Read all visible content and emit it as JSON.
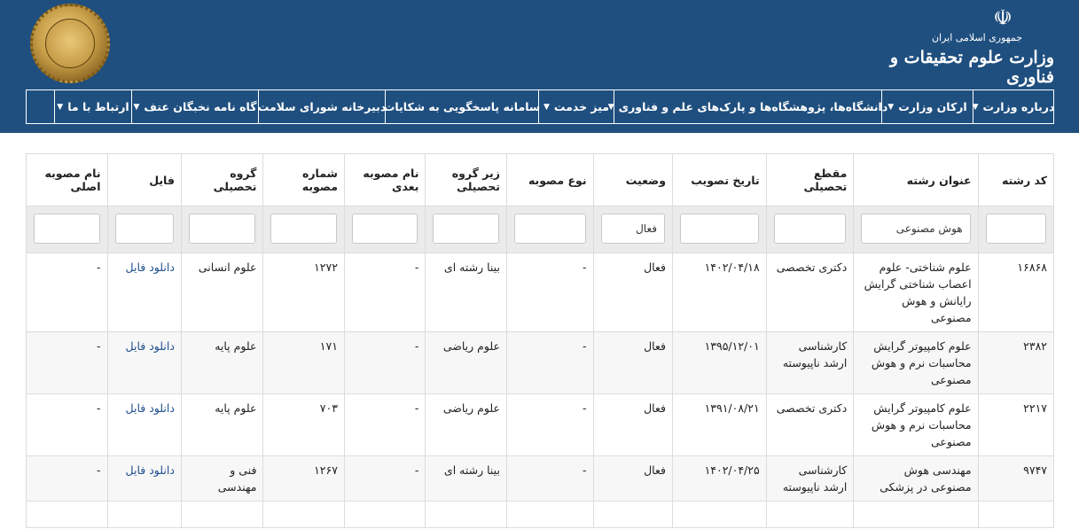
{
  "header": {
    "emblem_icon": "iran-emblem-icon",
    "ministry_small": "جمهوری اسلامی ایران",
    "ministry_name": "وزارت علوم تحقیقات و فناوری",
    "seal_icon": "gold-seal-icon"
  },
  "nav": {
    "items": [
      {
        "label": "درباره وزارت",
        "dropdown": true
      },
      {
        "label": "ارکان وزارت",
        "dropdown": true
      },
      {
        "label": "دانشگاه‌ها، پژوهشگاه‌ها و پارک‌های علم و فناوری",
        "dropdown": true
      },
      {
        "label": "میز خدمت",
        "dropdown": true
      },
      {
        "label": "سامانه پاسخگویی به شکایات",
        "dropdown": false
      },
      {
        "label": "دبیرخانه شورای سلامت",
        "dropdown": false
      },
      {
        "label": "گاه نامه نخبگان عتف",
        "dropdown": true
      },
      {
        "label": "ارتباط با ما",
        "dropdown": true
      },
      {
        "label": "",
        "dropdown": false
      }
    ]
  },
  "table": {
    "headers": [
      "کد رشته",
      "عنوان رشته",
      "مقطع تحصیلی",
      "تاریخ تصویب",
      "وضعیت",
      "نوع مصوبه",
      "زیر گروه تحصیلی",
      "نام مصوبه بعدی",
      "شماره مصوبه",
      "گروه تحصیلی",
      "فایل",
      "نام مصوبه اصلی"
    ],
    "filters": [
      "",
      "هوش مصنوعی",
      "",
      "",
      "فعال",
      "",
      "",
      "",
      "",
      "",
      "",
      ""
    ],
    "rows": [
      [
        "۱۶۸۶۸",
        "علوم شناختی- علوم اعصاب شناختی گرایش رایانش و هوش مصنوعی",
        "دکتری تخصصی",
        "۱۴۰۲/۰۴/۱۸",
        "فعال",
        "-",
        "بینا رشته ای",
        "-",
        "۱۲۷۲",
        "علوم انسانی",
        "دانلود فایل",
        "-"
      ],
      [
        "۲۳۸۲",
        "علوم کامپیوتر گرایش محاسبات نرم و هوش مصنوعی",
        "کارشناسی ارشد ناپیوسته",
        "۱۳۹۵/۱۲/۰۱",
        "فعال",
        "-",
        "علوم ریاضی",
        "-",
        "۱۷۱",
        "علوم پایه",
        "دانلود فایل",
        "-"
      ],
      [
        "۲۲۱۷",
        "علوم کامپیوتر گرایش محاسبات نرم و هوش مصنوعی",
        "دکتری تخصصی",
        "۱۳۹۱/۰۸/۲۱",
        "فعال",
        "-",
        "علوم ریاضی",
        "-",
        "۷۰۳",
        "علوم پایه",
        "دانلود فایل",
        "-"
      ],
      [
        "۹۷۴۷",
        "مهندسی هوش مصنوعی در پزشکی",
        "کارشناسی ارشد ناپیوسته",
        "۱۴۰۲/۰۴/۲۵",
        "فعال",
        "-",
        "بینا رشته ای",
        "-",
        "۱۲۶۷",
        "فنی و مهندسی",
        "دانلود فایل",
        "-"
      ],
      [
        "",
        "",
        "",
        "",
        "",
        "",
        "",
        "",
        "",
        "",
        "",
        ""
      ]
    ]
  },
  "colors": {
    "header_bg": "#1f4f7f",
    "link": "#1f4f8f",
    "filter_bg": "#ebebeb"
  }
}
